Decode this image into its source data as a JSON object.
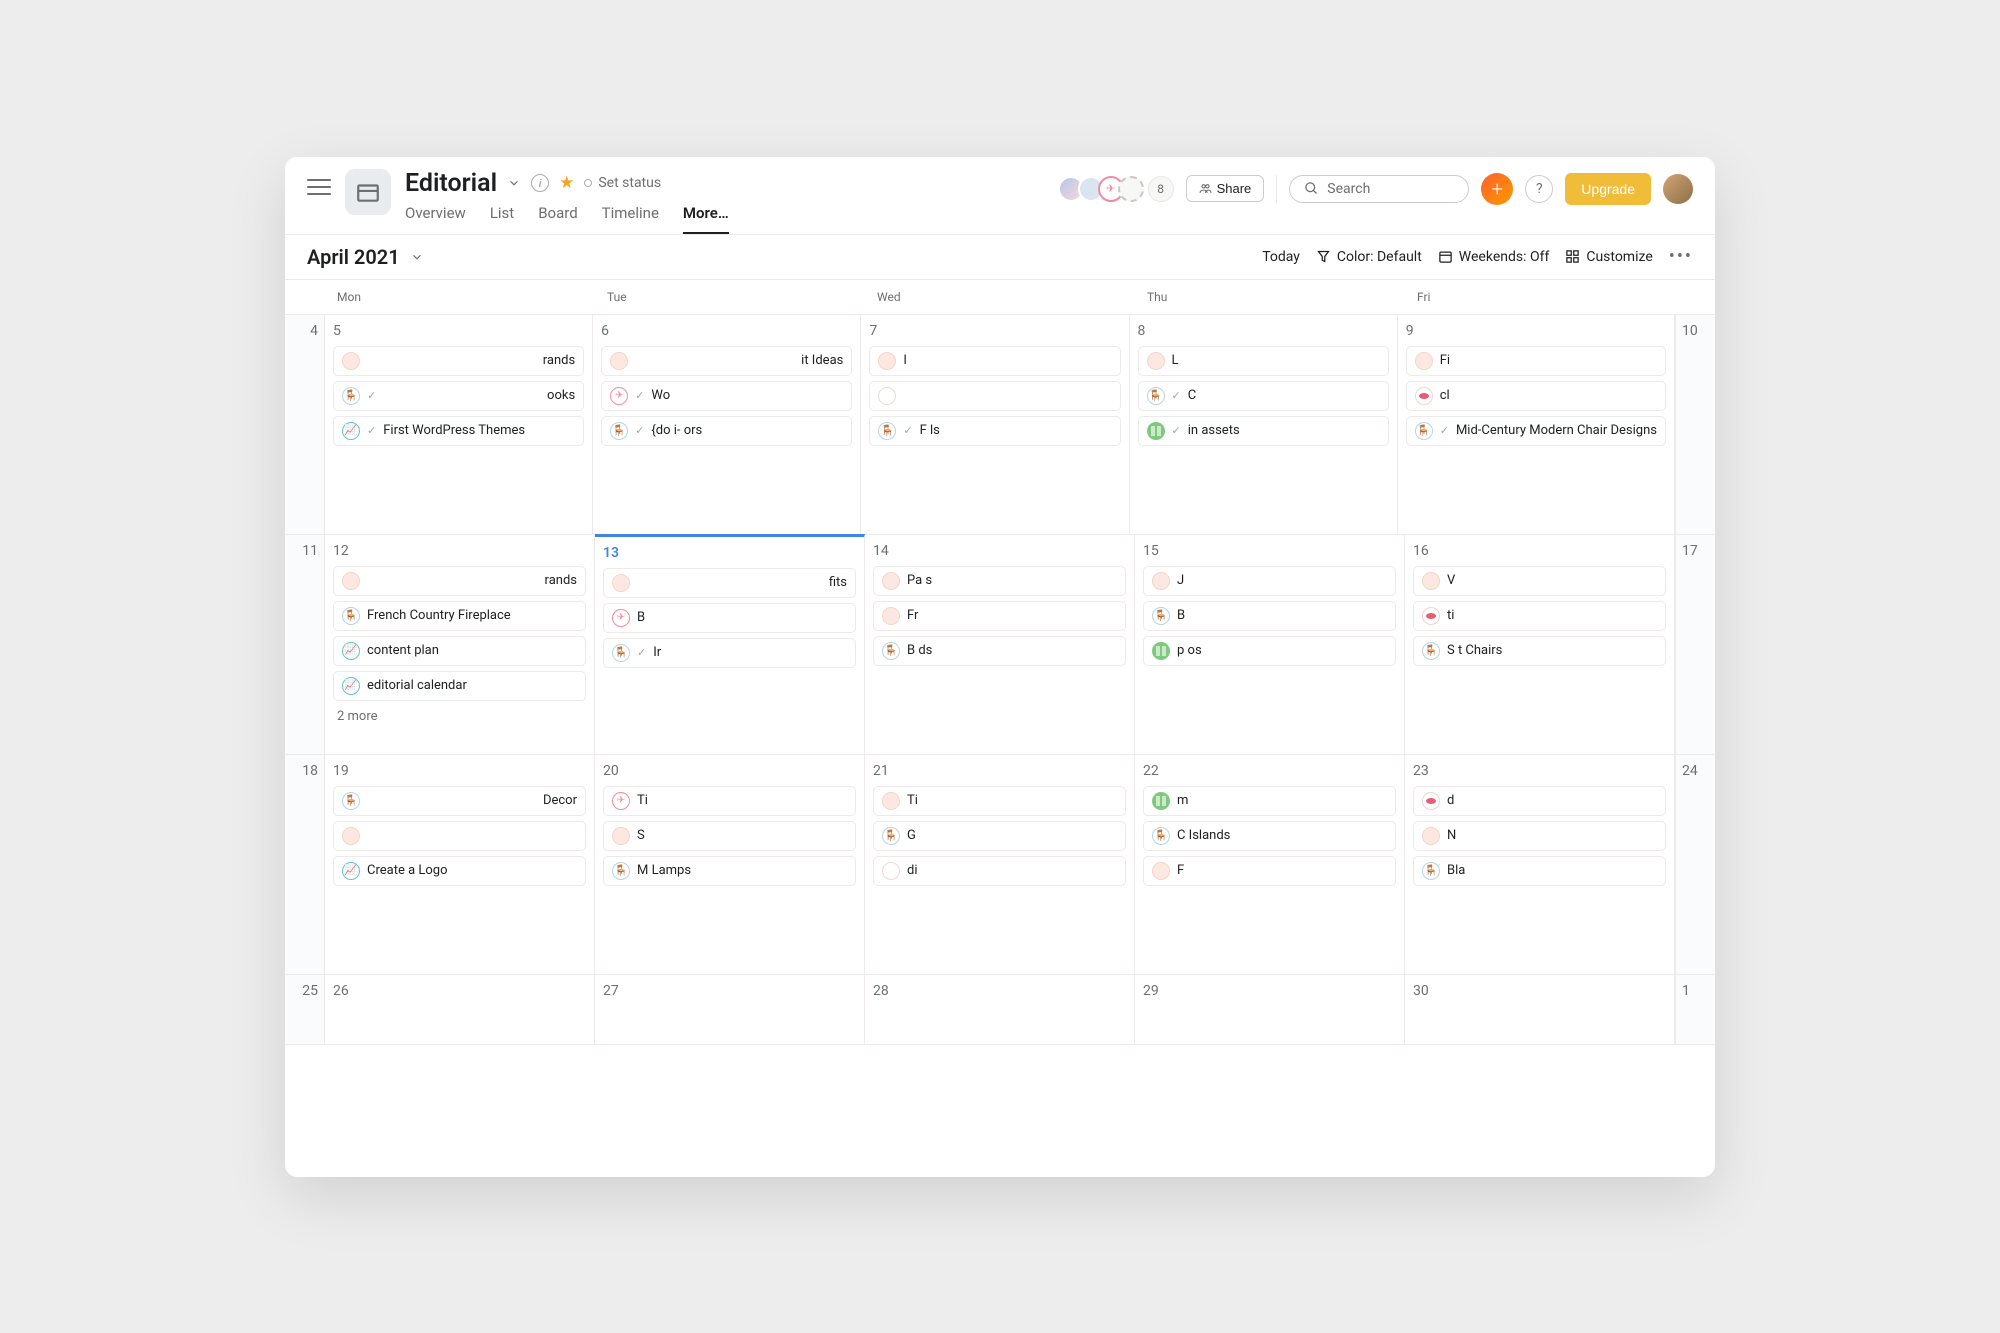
{
  "project": {
    "title": "Editorial",
    "status": "Set status"
  },
  "tabs": [
    {
      "label": "Overview",
      "active": false
    },
    {
      "label": "List",
      "active": false
    },
    {
      "label": "Board",
      "active": false
    },
    {
      "label": "Timeline",
      "active": false
    },
    {
      "label": "More…",
      "active": true
    }
  ],
  "avatar_count": "8",
  "share_label": "Share",
  "search_placeholder": "Search",
  "upgrade_label": "Upgrade",
  "month": "April 2021",
  "toolbar": {
    "today": "Today",
    "color": "Color: Default",
    "weekends": "Weekends: Off",
    "customize": "Customize"
  },
  "day_labels": [
    "Mon",
    "Tue",
    "Wed",
    "Thu",
    "Fri"
  ],
  "weeks": [
    {
      "left": "4",
      "right": "10",
      "days": [
        {
          "num": "5",
          "tasks": [
            {
              "icon": "peach",
              "text": "rands",
              "align": "r"
            },
            {
              "icon": "chair",
              "chk": true,
              "text": "ooks",
              "align": "r"
            },
            {
              "icon": "chart",
              "chk": true,
              "text": "First WordPress Themes"
            }
          ]
        },
        {
          "num": "6",
          "tasks": [
            {
              "icon": "peach",
              "text": "it Ideas",
              "align": "r"
            },
            {
              "icon": "plane",
              "chk": true,
              "text": "Wo"
            },
            {
              "icon": "chair",
              "chk": true,
              "text": "{do             i-\nors"
            }
          ]
        },
        {
          "num": "7",
          "tasks": [
            {
              "icon": "peach",
              "text": "I"
            },
            {
              "icon": "blank",
              "text": ""
            },
            {
              "icon": "chair",
              "chk": true,
              "text": "F                 ls"
            }
          ]
        },
        {
          "num": "8",
          "tasks": [
            {
              "icon": "peach",
              "text": "L"
            },
            {
              "icon": "chair",
              "chk": true,
              "text": "C"
            },
            {
              "icon": "green",
              "chk": true,
              "text": "in\nassets"
            }
          ]
        },
        {
          "num": "9",
          "tasks": [
            {
              "icon": "peach",
              "text": "Fi"
            },
            {
              "icon": "red",
              "text": "cl"
            },
            {
              "icon": "chair",
              "chk": true,
              "text": "Mid-Century Modern Chair Designs"
            }
          ]
        }
      ]
    },
    {
      "left": "11",
      "right": "17",
      "days": [
        {
          "num": "12",
          "tasks": [
            {
              "icon": "peach",
              "text": "rands",
              "align": "r"
            },
            {
              "icon": "chair",
              "text": "French Country Fireplace"
            },
            {
              "icon": "chart",
              "text": "content plan"
            },
            {
              "icon": "chart",
              "text": "editorial calendar"
            }
          ],
          "more": "2 more"
        },
        {
          "num": "13",
          "today": true,
          "tasks": [
            {
              "icon": "peach",
              "text": "fits",
              "align": "r"
            },
            {
              "icon": "plane",
              "text": "B"
            },
            {
              "icon": "chair",
              "chk": true,
              "text": "Ir"
            }
          ]
        },
        {
          "num": "14",
          "tasks": [
            {
              "icon": "peach",
              "text": "Pa                s"
            },
            {
              "icon": "peach",
              "text": "Fr"
            },
            {
              "icon": "chair",
              "text": "B                 ds"
            }
          ]
        },
        {
          "num": "15",
          "tasks": [
            {
              "icon": "peach",
              "text": "J"
            },
            {
              "icon": "chair",
              "text": "B"
            },
            {
              "icon": "green",
              "text": "p                 os"
            }
          ]
        },
        {
          "num": "16",
          "tasks": [
            {
              "icon": "peach",
              "text": "V"
            },
            {
              "icon": "red",
              "text": "ti"
            },
            {
              "icon": "chair",
              "text": "S                  t\nChairs"
            }
          ]
        }
      ]
    },
    {
      "left": "18",
      "right": "24",
      "days": [
        {
          "num": "19",
          "tasks": [
            {
              "icon": "chair",
              "text": "Decor",
              "align": "r"
            },
            {
              "icon": "peach",
              "text": ""
            },
            {
              "icon": "chart",
              "text": "Create a Logo"
            }
          ]
        },
        {
          "num": "20",
          "tasks": [
            {
              "icon": "plane",
              "text": "Ti"
            },
            {
              "icon": "peach",
              "text": "S"
            },
            {
              "icon": "chair",
              "text": "M\nLamps"
            }
          ]
        },
        {
          "num": "21",
          "tasks": [
            {
              "icon": "peach",
              "text": "Ti"
            },
            {
              "icon": "chair",
              "text": "G"
            },
            {
              "icon": "blank",
              "text": "di"
            }
          ]
        },
        {
          "num": "22",
          "tasks": [
            {
              "icon": "green",
              "text": "m"
            },
            {
              "icon": "chair",
              "text": "C\nIslands"
            },
            {
              "icon": "peach",
              "text": "F"
            }
          ]
        },
        {
          "num": "23",
          "tasks": [
            {
              "icon": "red",
              "text": "d"
            },
            {
              "icon": "peach",
              "text": "N"
            },
            {
              "icon": "chair",
              "text": "Bla"
            }
          ]
        }
      ]
    },
    {
      "left": "25",
      "right": "1",
      "short": true,
      "days": [
        {
          "num": "26",
          "tasks": []
        },
        {
          "num": "27",
          "tasks": []
        },
        {
          "num": "28",
          "tasks": []
        },
        {
          "num": "29",
          "tasks": []
        },
        {
          "num": "30",
          "tasks": []
        }
      ]
    }
  ]
}
